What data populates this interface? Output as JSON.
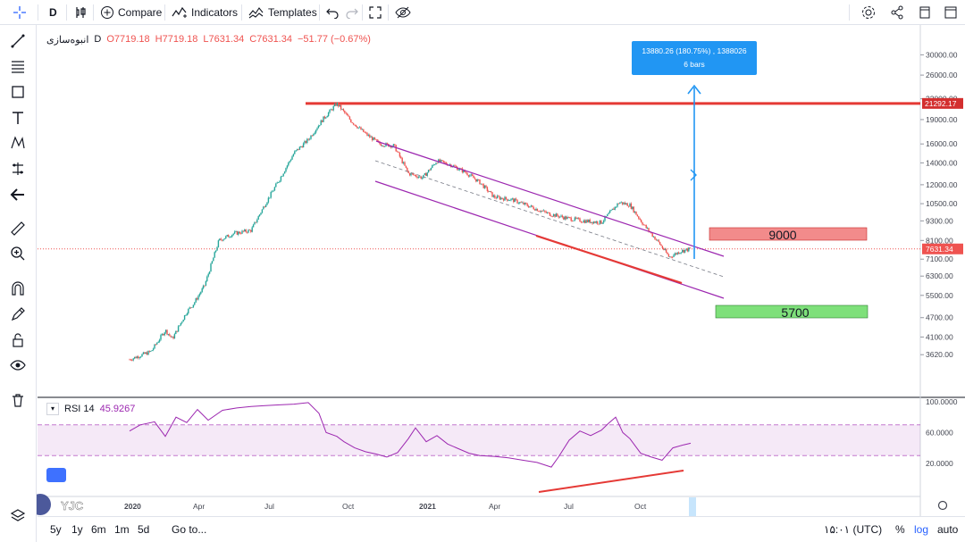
{
  "toolbar": {
    "interval": "D",
    "compare": "Compare",
    "indicators": "Indicators",
    "templates": "Templates"
  },
  "legend": {
    "symbol": "انبوه‌سازی",
    "interval": "D",
    "open": "O7719.18",
    "high": "H7719.18",
    "low": "L7631.34",
    "close": "C7631.34",
    "change": "−51.77 (−0.67%)"
  },
  "rsi": {
    "label": "RSI 14",
    "value": "45.9267"
  },
  "measure": {
    "line1": "13880.26 (180.75%) , 1388026",
    "line2": "6 bars"
  },
  "annotations": {
    "resistance_label": "21292.17",
    "target_high": "9000",
    "target_low": "5700",
    "last_price": "7631.34"
  },
  "bottom": {
    "ranges": [
      "5y",
      "1y",
      "6m",
      "1m",
      "5d"
    ],
    "goto": "Go to...",
    "time": "۱۵:۰۱ (UTC)",
    "percent": "%",
    "log": "log",
    "auto": "auto"
  },
  "watermark": "YJC",
  "colors": {
    "up": "#26a69a",
    "down": "#ef5350",
    "channel": "#9c27b0",
    "support": "#e53935",
    "measure": "#2196f3"
  },
  "chart_data": {
    "type": "candlestick",
    "scale": "log",
    "price_axis": [
      "30000.00",
      "26000.00",
      "22000.00",
      "19000.00",
      "16000.00",
      "14000.00",
      "12000.00",
      "10500.00",
      "9300.00",
      "8100.00",
      "7100.00",
      "6300.00",
      "5500.00",
      "4700.00",
      "4100.00",
      "3620.00"
    ],
    "rsi_axis": [
      "100.0000",
      "60.0000",
      "20.0000"
    ],
    "rsi_band": [
      30,
      70
    ],
    "time_axis": [
      "2020",
      "Apr",
      "Jul",
      "Oct",
      "2021",
      "Apr",
      "Jul",
      "Oct"
    ],
    "series": [
      {
        "name": "انبوه‌سازی",
        "type": "candlestick"
      },
      {
        "name": "RSI 14",
        "type": "line"
      }
    ],
    "price_path": [
      [
        2.0,
        3500
      ],
      [
        2.6,
        3700
      ],
      [
        3.0,
        4300
      ],
      [
        3.2,
        4050
      ],
      [
        3.6,
        4900
      ],
      [
        3.8,
        5200
      ],
      [
        4.1,
        5900
      ],
      [
        4.5,
        8100
      ],
      [
        4.9,
        8500
      ],
      [
        5.4,
        8700
      ],
      [
        5.8,
        10500
      ],
      [
        6.2,
        12500
      ],
      [
        6.6,
        15000
      ],
      [
        7.0,
        16500
      ],
      [
        7.4,
        19000
      ],
      [
        7.8,
        21292
      ],
      [
        8.2,
        18800
      ],
      [
        8.6,
        17200
      ],
      [
        9.0,
        16000
      ],
      [
        9.4,
        15800
      ],
      [
        9.8,
        13000
      ],
      [
        10.2,
        12600
      ],
      [
        10.6,
        14200
      ],
      [
        11.0,
        13800
      ],
      [
        11.4,
        13100
      ],
      [
        11.8,
        12200
      ],
      [
        12.2,
        11000
      ],
      [
        12.7,
        10800
      ],
      [
        13.2,
        10300
      ],
      [
        13.7,
        9800
      ],
      [
        14.2,
        9500
      ],
      [
        14.7,
        9300
      ],
      [
        15.2,
        9200
      ],
      [
        15.7,
        10600
      ],
      [
        16.0,
        10400
      ],
      [
        16.4,
        9000
      ],
      [
        16.8,
        8000
      ],
      [
        17.1,
        7200
      ],
      [
        17.4,
        7500
      ],
      [
        17.7,
        7631
      ]
    ],
    "rsi_path": [
      [
        2.0,
        62
      ],
      [
        2.3,
        70
      ],
      [
        2.7,
        74
      ],
      [
        3.0,
        55
      ],
      [
        3.3,
        80
      ],
      [
        3.6,
        73
      ],
      [
        3.9,
        90
      ],
      [
        4.2,
        76
      ],
      [
        4.6,
        89
      ],
      [
        5.0,
        92
      ],
      [
        5.4,
        94
      ],
      [
        5.8,
        95
      ],
      [
        6.2,
        96
      ],
      [
        6.6,
        97
      ],
      [
        7.0,
        99
      ],
      [
        7.3,
        85
      ],
      [
        7.5,
        60
      ],
      [
        7.8,
        55
      ],
      [
        8.0,
        48
      ],
      [
        8.3,
        40
      ],
      [
        8.6,
        35
      ],
      [
        8.9,
        32
      ],
      [
        9.2,
        28
      ],
      [
        9.5,
        34
      ],
      [
        9.8,
        52
      ],
      [
        10.0,
        66
      ],
      [
        10.3,
        48
      ],
      [
        10.6,
        56
      ],
      [
        10.9,
        45
      ],
      [
        11.2,
        39
      ],
      [
        11.5,
        33
      ],
      [
        11.8,
        30
      ],
      [
        12.2,
        29
      ],
      [
        12.6,
        27
      ],
      [
        13.0,
        24
      ],
      [
        13.4,
        21
      ],
      [
        13.8,
        15
      ],
      [
        14.0,
        28
      ],
      [
        14.3,
        50
      ],
      [
        14.6,
        62
      ],
      [
        14.9,
        56
      ],
      [
        15.2,
        63
      ],
      [
        15.4,
        72
      ],
      [
        15.6,
        80
      ],
      [
        15.8,
        60
      ],
      [
        16.0,
        52
      ],
      [
        16.3,
        33
      ],
      [
        16.6,
        28
      ],
      [
        16.9,
        24
      ],
      [
        17.2,
        40
      ],
      [
        17.5,
        44
      ],
      [
        17.7,
        46
      ]
    ]
  }
}
